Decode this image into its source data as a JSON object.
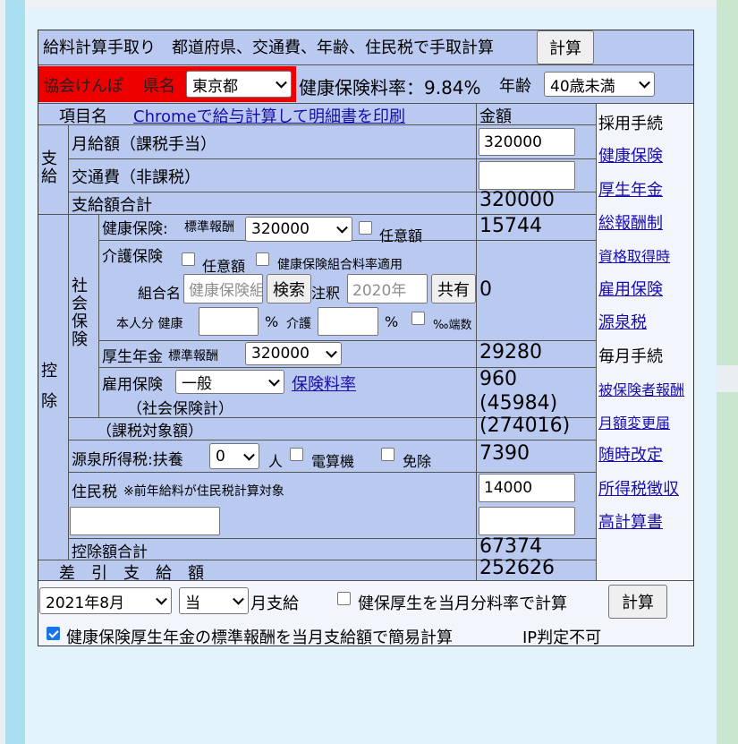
{
  "header": {
    "title": "給料計算手取り　都道府県、交通費、年齢、住民税で手取計算",
    "calc_button": "計算"
  },
  "settings": {
    "association": "協会けんぽ",
    "prefecture_label": "県名",
    "prefecture": "東京都",
    "health_rate": "健康保険料率：9.84%",
    "age_label": "年齢",
    "age": "40歳未満"
  },
  "table": {
    "item_header": "項目名",
    "print_link": "Chromeで給与計算して明細書を印刷",
    "amount_header": "金額",
    "payment_label": "支給",
    "deduction_label": "控除",
    "social_label": "社会保険",
    "monthly_salary_label": "月給額（課税手当）",
    "monthly_salary": "320000",
    "transport_label": "交通費（非課税）",
    "transport": "",
    "payment_total_label": "支給額合計",
    "payment_total": "320000",
    "health_label": "健康保険:",
    "health_std_label": "標準報酬",
    "health_std": "320000",
    "optional_label": "任意額",
    "health_amount": "15744",
    "care_label": "介護保険",
    "care_optional_label": "任意額",
    "union_rate_label": "健康保険組合料率適用",
    "union_name_label": "組合名",
    "union_name_placeholder": "健康保険組合",
    "search_button": "検索",
    "note_label": "注釈",
    "note_placeholder": "2020年",
    "share_button": "共有",
    "care_amount": "0",
    "self_share_label": "本人分 健康",
    "percent1": "%",
    "care_short_label": "介護",
    "percent2": "%",
    "rounding_label": "‰端数",
    "pension_label": "厚生年金",
    "pension_std_label": "標準報酬",
    "pension_std": "320000",
    "pension_amount": "29280",
    "employment_label": "雇用保険",
    "employment_type": "一般",
    "employment_rate_link": "保険料率",
    "employment_amount": "960",
    "social_total_label": "（社会保険計）",
    "social_total": "(45984)",
    "taxable_label": "（課税対象額）",
    "taxable": "(274016)",
    "income_tax_label": "源泉所得税:扶養",
    "dependents": "0",
    "persons_label": "人",
    "calculator_label": "電算機",
    "exempt_label": "免除",
    "income_tax": "7390",
    "resident_label": "住民税",
    "resident_note": "※前年給料が住民税計算対象",
    "resident_tax": "14000",
    "deduction_total_label": "控除額合計",
    "deduction_total": "67374",
    "net_label": "差　引　支　給　額",
    "net": "252626"
  },
  "sidebar": {
    "hire_procedure": "採用手続",
    "monthly_procedure": "毎月手続",
    "links_top": [
      "健康保険",
      "厚生年金",
      "総報酬制"
    ],
    "link_acquisition": "資格取得時",
    "links_mid": [
      "雇用保険",
      "源泉税"
    ],
    "link_insured_reward": "被保険者報酬",
    "link_monthly_change": "月額変更届",
    "links_bottom": [
      "随時改定",
      "所得税徴収",
      "高計算書"
    ]
  },
  "footer": {
    "month": "2021年8月",
    "current": "当",
    "month_pay_label": "月支給",
    "current_rate_label": "健保厚生を当月分料率で計算",
    "calc_button": "計算",
    "simple_calc_label": "健康保険厚生年金の標準報酬を当月支給額で簡易計算",
    "ip_label": "IP判定不可"
  },
  "colors": {
    "frame": "#b9c9ef",
    "side": "#f2f5fc",
    "association_bg": "#ee0000",
    "link": "#1a0dab"
  }
}
